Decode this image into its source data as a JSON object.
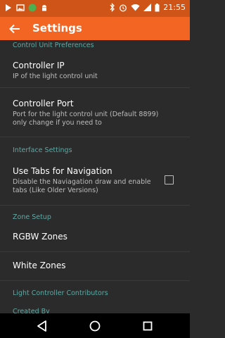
{
  "status_bar": {
    "time": "21:55",
    "left_icons": [
      "play-store-icon",
      "image-icon",
      "circle-app-icon",
      "android-icon"
    ],
    "right_icons": [
      "bluetooth-icon",
      "alarm-icon",
      "wifi-icon",
      "signal-icon",
      "battery-icon"
    ]
  },
  "app_bar": {
    "title": "Settings",
    "back_icon": "back-arrow-icon"
  },
  "sections": {
    "control_unit": {
      "header": "Control Unit Preferences",
      "controller_ip": {
        "title": "Controller IP",
        "summary": "IP of the light control unit"
      },
      "controller_port": {
        "title": "Controller Port",
        "summary": "Port for the light control unit (Default 8899) only change if you need to"
      }
    },
    "interface": {
      "header": "Interface Settings",
      "use_tabs": {
        "title": "Use Tabs for Navigation",
        "summary": "Disable the Naviagation draw and enable tabs (Like Older Versions)",
        "checked": false
      }
    },
    "zone_setup": {
      "header": "Zone Setup",
      "rgbw_zones": "RGBW Zones",
      "white_zones": "White Zones"
    },
    "contributors": {
      "header": "Light Controller Contributors",
      "created_by": "Created By"
    }
  },
  "nav_bar": {
    "back": "nav-back-icon",
    "home": "nav-home-icon",
    "recents": "nav-recents-icon"
  },
  "colors": {
    "status_bar": "#cf5418",
    "app_bar": "#f26522",
    "background": "#2b2b2b",
    "category_text": "#5fa9a4"
  }
}
